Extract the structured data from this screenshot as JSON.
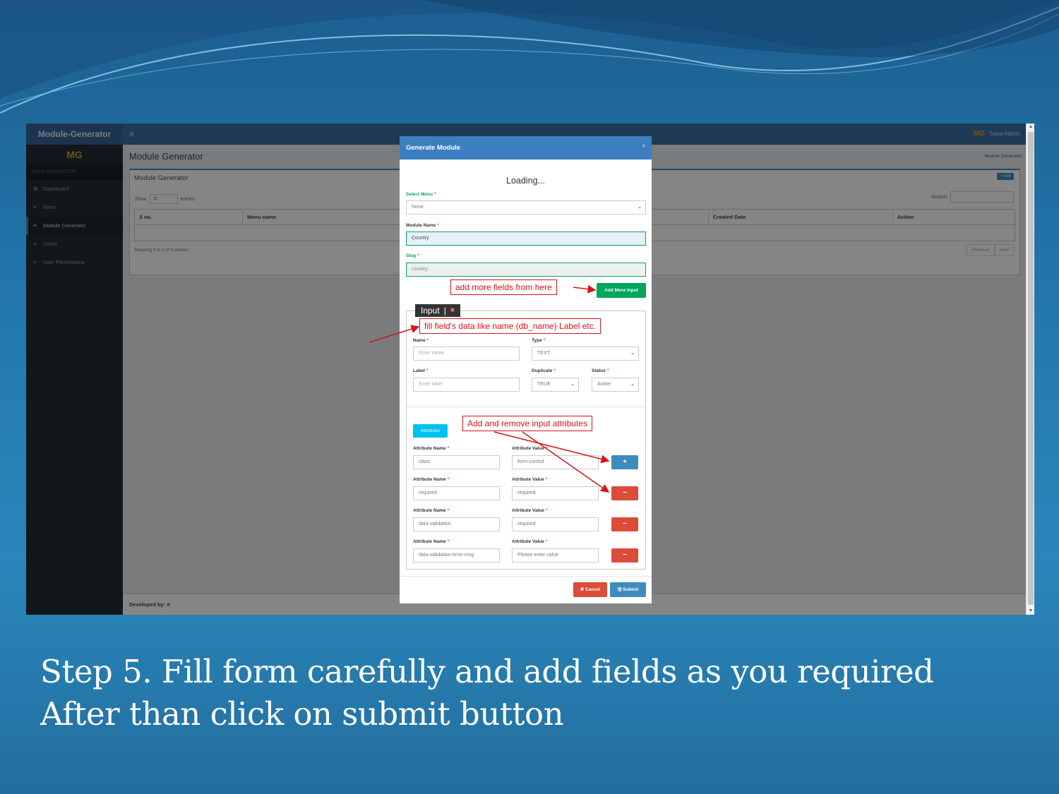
{
  "slide": {
    "caption_line1": "Step 5. Fill form carefully and add fields as you required",
    "caption_line2": "After than click on submit button"
  },
  "app": {
    "brand": "Module-Generator",
    "menu_icon": "≡",
    "user_logo": "MG",
    "user_name": "SuperAdmin",
    "sidebar": {
      "logo": "MG",
      "section_label": "MAIN NAVIGATION",
      "items": [
        {
          "icon": "dashboard-icon",
          "glyph": "⊞",
          "label": "Dashboard"
        },
        {
          "icon": "list-icon",
          "glyph": "≡",
          "label": "Menu"
        },
        {
          "icon": "list-icon",
          "glyph": "≡",
          "label": "Module Generator"
        },
        {
          "icon": "list-icon",
          "glyph": "≡",
          "label": "Users"
        },
        {
          "icon": "list-icon",
          "glyph": "≡",
          "label": "User Permissions"
        }
      ]
    },
    "page_title": "Module Generator",
    "breadcrumb": "Module Generator",
    "box_title": "Module Generator",
    "add_label": "+ Add",
    "show_label": "Show",
    "show_value": "10",
    "entries_label": "entries",
    "search_label": "Search:",
    "columns": [
      "S no.",
      "Menu name",
      "",
      "Created Date",
      "Action"
    ],
    "showing_text": "Showing 0 to 0 of 0 entries",
    "pager": [
      "Previous",
      "Next"
    ],
    "footer": "Developed by: #"
  },
  "modal": {
    "title": "Generate Module",
    "close": "×",
    "loading": "Loading...",
    "select_menu_label": "Select Menu",
    "select_menu_value": "None",
    "module_name_label": "Module Name",
    "module_name_value": "Country",
    "slug_label": "Slug",
    "slug_value": "country",
    "add_more_label": "Add More Input",
    "input_tag": "Input",
    "input_sep": "|",
    "trash": "🗑",
    "name_label": "Name",
    "name_placeholder": "Enter name",
    "type_label": "Type",
    "type_value": "TEXT",
    "label_label": "Label",
    "label_placeholder": "Enter label",
    "duplicate_label": "Duplicate",
    "duplicate_value": "TRUE",
    "status_label": "Status",
    "status_value": "Active",
    "attributes_button": "Attributes",
    "attr_name_label": "Attribute Name",
    "attr_value_label": "Attribute Value",
    "attributes": [
      {
        "name": "class",
        "value": "form-control",
        "action": "+"
      },
      {
        "name": "required",
        "value": "required",
        "action": "−"
      },
      {
        "name": "data-validation",
        "value": "required",
        "action": "−"
      },
      {
        "name": "data-validation-error-msg",
        "value": "Please enter value",
        "action": "−"
      }
    ],
    "cancel_label": "✖ Cancel",
    "submit_label": "🖫 Submit"
  },
  "callouts": {
    "add_more": "add more fields from here",
    "fill_data": "fill field's data like name (db_name) Label etc.",
    "attributes": "Add and remove input attributes"
  },
  "colors": {
    "header_blue": "#3c6fa3",
    "modal_header": "#3c7fc0",
    "green": "#00a65a",
    "red": "#dd4b39",
    "annotation_red": "#d6141a"
  }
}
